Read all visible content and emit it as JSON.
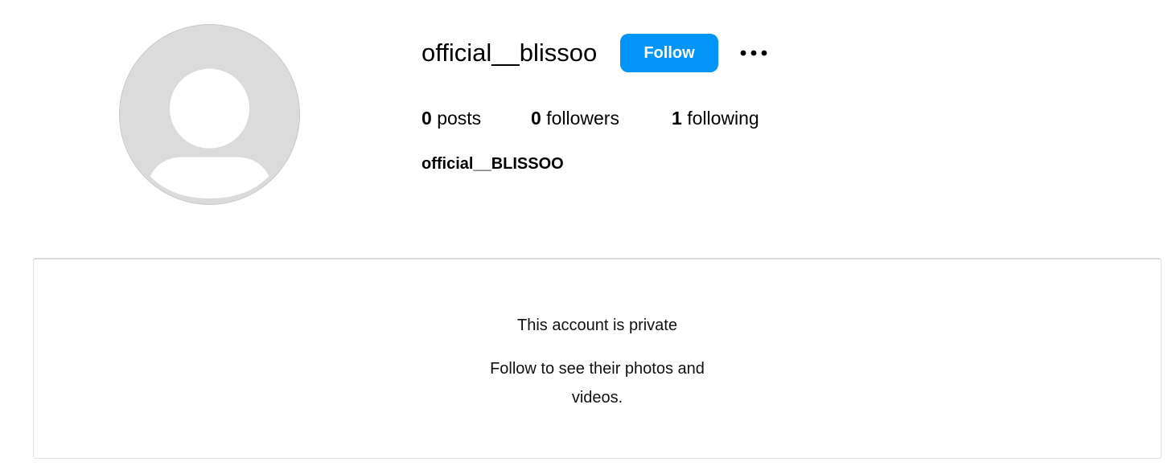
{
  "profile": {
    "username": "official__blissoo",
    "full_name": "official__BLISSOO",
    "follow_label": "Follow",
    "more_icon": "more-dots-icon",
    "avatar_icon": "default-avatar-icon"
  },
  "stats": {
    "posts_count": "0",
    "posts_label": "posts",
    "followers_count": "0",
    "followers_label": "followers",
    "following_count": "1",
    "following_label": "following"
  },
  "private_notice": {
    "title": "This account is private",
    "subtitle": "Follow to see their photos and videos."
  },
  "colors": {
    "accent": "#0095f6",
    "avatar_bg": "#dbdbdb",
    "border": "#dbdbdb"
  }
}
